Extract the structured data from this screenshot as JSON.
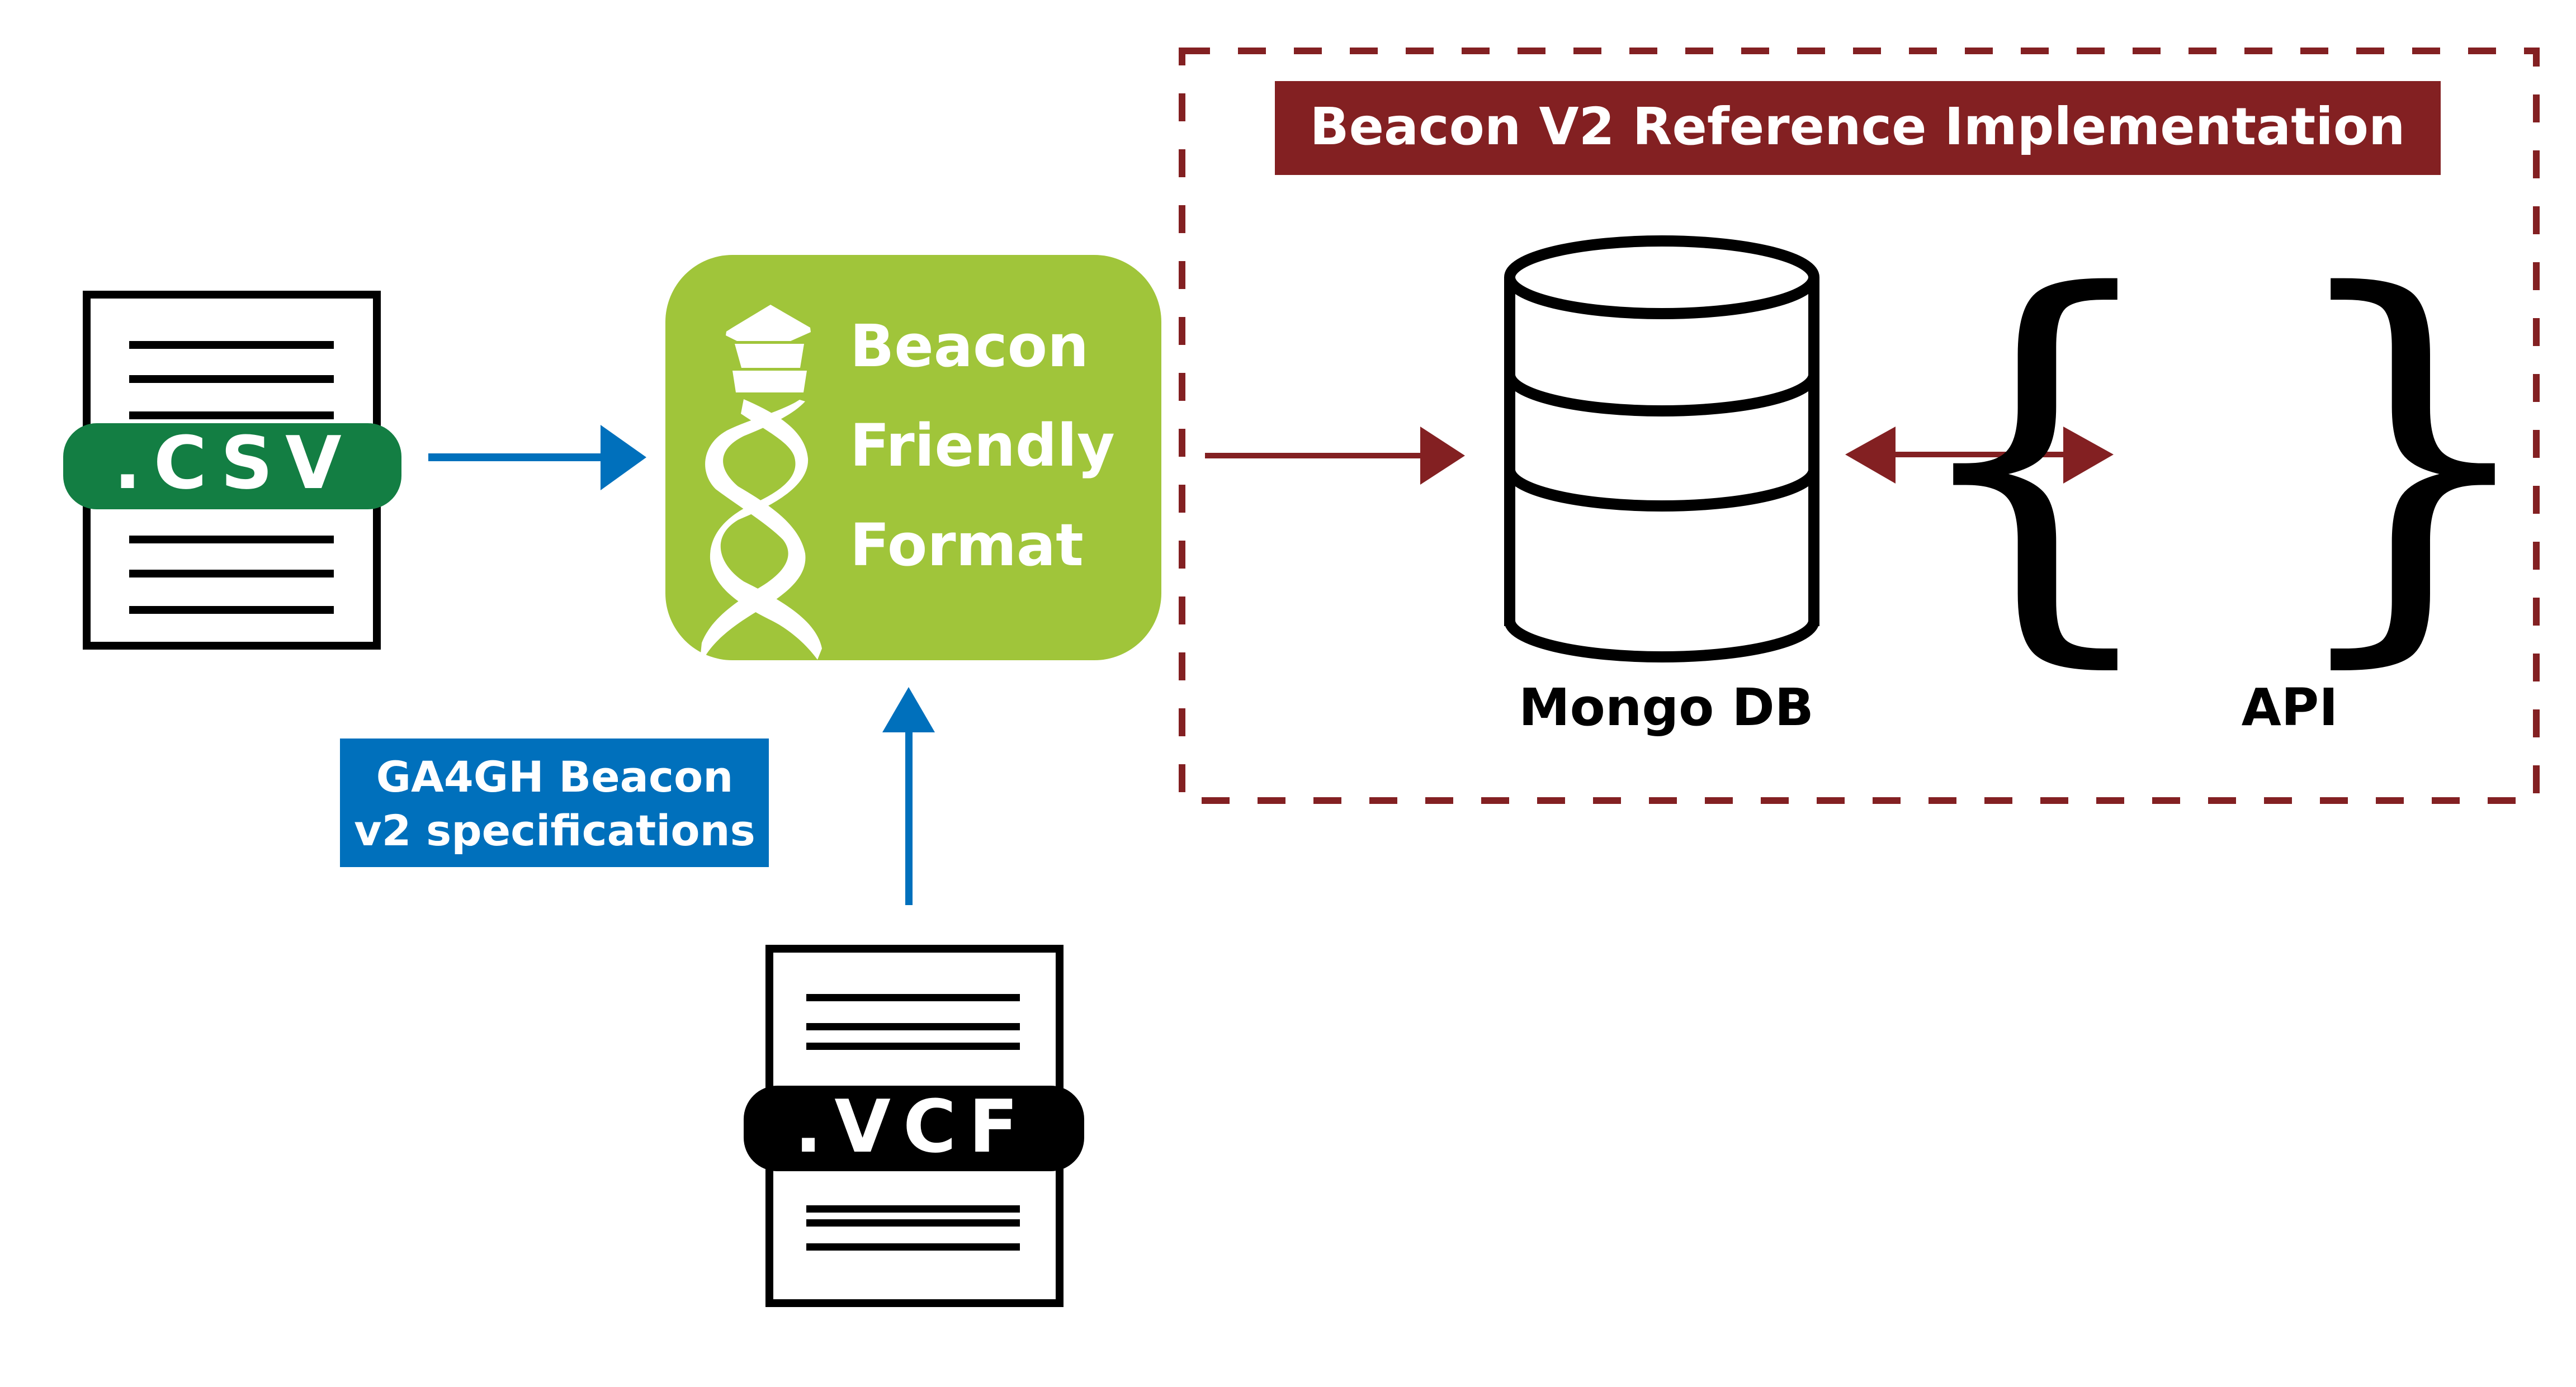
{
  "colors": {
    "csv_green": "#137e43",
    "bff_green": "#a0c53a",
    "blue": "#0070bc",
    "maroon": "#832022",
    "black": "#000000",
    "white": "#ffffff"
  },
  "nodes": {
    "csv": {
      "label": ".CSV",
      "icon": "document-icon"
    },
    "vcf": {
      "label": ".VCF",
      "icon": "document-icon"
    },
    "bff": {
      "lines": [
        "Beacon",
        "Friendly",
        "Format"
      ],
      "icon": "beacon-dna-logo-icon"
    },
    "spec": {
      "lines": [
        "GA4GH Beacon",
        "v2 specifications"
      ]
    },
    "reference_impl": {
      "title": "Beacon V2 Reference Implementation"
    },
    "mongodb": {
      "label": "Mongo DB",
      "icon": "database-icon"
    },
    "api": {
      "label": "API",
      "icon": "curly-braces-icon"
    }
  },
  "edges": [
    {
      "from": "csv",
      "to": "bff",
      "color": "blue",
      "direction": "forward"
    },
    {
      "from": "vcf",
      "to": "bff",
      "color": "blue",
      "direction": "forward"
    },
    {
      "from": "bff",
      "to": "mongodb",
      "color": "maroon",
      "direction": "forward"
    },
    {
      "from": "mongodb",
      "to": "api",
      "color": "maroon",
      "direction": "bidirectional"
    }
  ]
}
